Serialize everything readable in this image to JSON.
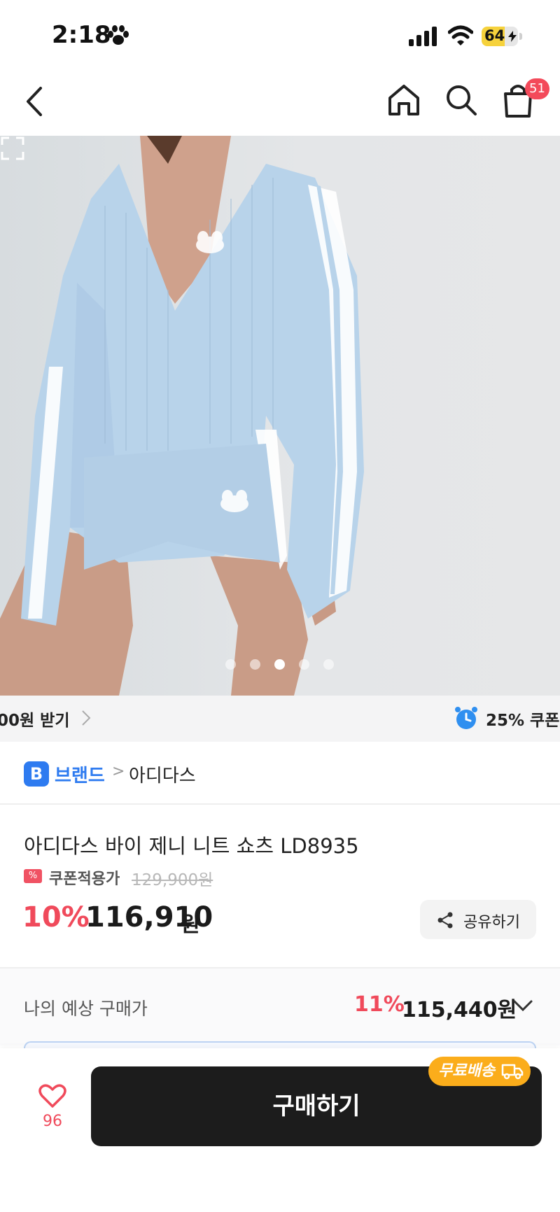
{
  "status_bar": {
    "time": "2:18",
    "battery_level": "64",
    "battery_fill_percent": 64,
    "icons": [
      "paw-icon",
      "signal-icon",
      "wifi-icon",
      "battery-charging-icon"
    ]
  },
  "nav": {
    "icons": [
      "back-arrow-icon",
      "home-icon",
      "search-icon",
      "shopping-bag-icon"
    ],
    "cart_count": "51"
  },
  "hero": {
    "image_description_icon": "product-photo",
    "slide_count": 5,
    "active_slide": 3
  },
  "promo": {
    "left_text": "00원 받기",
    "right_text": "25% 쿠폰 ."
  },
  "brand": {
    "badge": "B",
    "label": "브랜드",
    "separator": ">",
    "name": "아디다스"
  },
  "product": {
    "title": "아디다스 바이 제니 니트 쇼츠 LD8935",
    "coupon_label": "쿠폰적용가",
    "original_price": "129,900원",
    "discount": "10%",
    "price": "116,910",
    "price_unit": "원",
    "share_label": "공유하기"
  },
  "expected": {
    "label": "나의 예상 구매가",
    "discount": "11%",
    "price": "115,440원"
  },
  "bottom": {
    "like_count": "96",
    "buy_label": "구매하기",
    "free_shipping": "무료배송"
  },
  "colors": {
    "accent_red": "#f04a5b",
    "brand_blue": "#2e7bf0",
    "shipping_orange": "#fbad1b",
    "buy_button": "#1c1c1c"
  }
}
